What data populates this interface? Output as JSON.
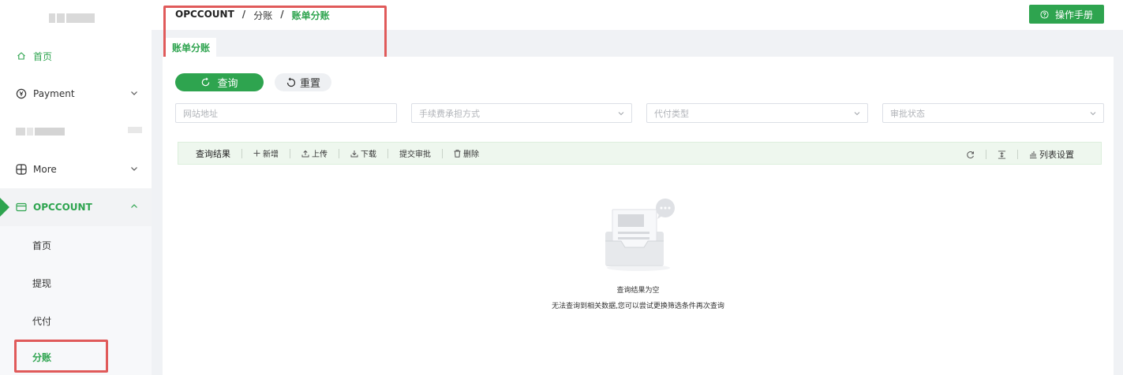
{
  "sidebar": {
    "items": [
      {
        "label": "首页",
        "icon": "home-icon"
      },
      {
        "label": "Payment",
        "icon": "yen-coin-icon"
      },
      {
        "label": "",
        "icon": "blurred"
      },
      {
        "label": "More",
        "icon": "grid-icon"
      },
      {
        "label": "OPCCOUNT",
        "icon": "card-icon"
      }
    ],
    "sub_items": [
      "首页",
      "提现",
      "代付",
      "分账"
    ],
    "active_sub": "分账",
    "accent": "#2ea44f"
  },
  "header": {
    "breadcrumb": [
      "OPCCOUNT",
      "分账",
      "账单分账"
    ],
    "manual_label": "操作手册"
  },
  "tabs": [
    {
      "label": "账单分账",
      "active": true
    }
  ],
  "search": {
    "query_label": "查询",
    "reset_label": "重置",
    "fields": [
      {
        "placeholder": "网站地址",
        "type": "input"
      },
      {
        "placeholder": "手续费承担方式",
        "type": "select"
      },
      {
        "placeholder": "代付类型",
        "type": "select"
      },
      {
        "placeholder": "审批状态",
        "type": "select"
      }
    ]
  },
  "toolbar": {
    "title": "查询结果",
    "add": "新增",
    "upload": "上传",
    "download": "下载",
    "submit": "提交审批",
    "delete": "删除",
    "columns": "列表设置"
  },
  "empty": {
    "title": "查询结果为空",
    "subtitle": "无法查询到相关数据,您可以尝试更换筛选条件再次查询"
  }
}
